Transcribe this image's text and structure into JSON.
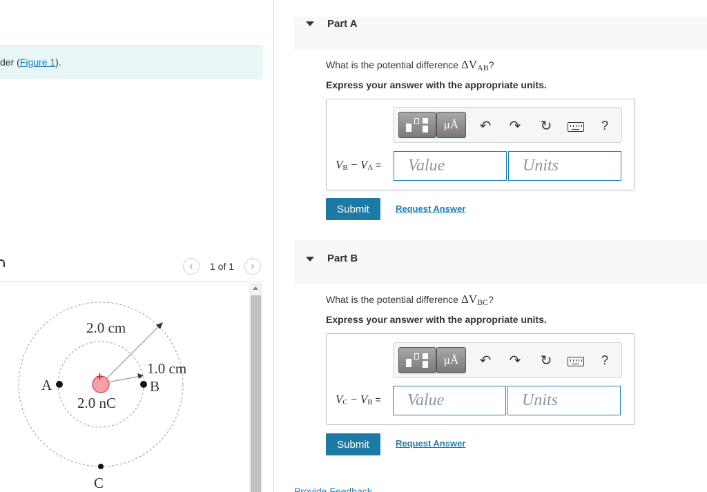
{
  "intro": {
    "text_prefix": "der (",
    "figure_link": "Figure 1",
    "text_suffix": ")."
  },
  "figure": {
    "pager": {
      "prev_icon": "chevron-left-icon",
      "next_icon": "chevron-right-icon",
      "current": "1 of 1"
    },
    "labels": {
      "point_a": "A",
      "point_b": "B",
      "point_c": "C",
      "charge_sign": "+",
      "charge_value": "2.0 nC",
      "outer_radius": "2.0 cm",
      "inner_radius": "1.0 cm"
    },
    "colors": {
      "charge_fill": "#f6a0a8",
      "charge_stroke": "#e0505e",
      "circle": "#999999"
    }
  },
  "parts": [
    {
      "title": "Part A",
      "question_prefix": "What is the potential difference ",
      "question_symbol": "ΔV",
      "question_sub": "AB",
      "question_suffix": "?",
      "instruction": "Express your answer with the appropriate units.",
      "toolbar": {
        "units_symbol": "μÅ",
        "undo_icon": "undo-icon",
        "redo_icon": "redo-icon",
        "reset_icon": "reset-icon",
        "keyboard_icon": "keyboard-icon",
        "help": "?"
      },
      "eq": {
        "v1": "V",
        "s1": "B",
        "minus": " − ",
        "v2": "V",
        "s2": "A",
        "equals": " ="
      },
      "value_placeholder": "Value",
      "units_placeholder": "Units",
      "submit": "Submit",
      "request": "Request Answer"
    },
    {
      "title": "Part B",
      "question_prefix": "What is the potential difference ",
      "question_symbol": "ΔV",
      "question_sub": "BC",
      "question_suffix": "?",
      "instruction": "Express your answer with the appropriate units.",
      "toolbar": {
        "units_symbol": "μÅ",
        "undo_icon": "undo-icon",
        "redo_icon": "redo-icon",
        "reset_icon": "reset-icon",
        "keyboard_icon": "keyboard-icon",
        "help": "?"
      },
      "eq": {
        "v1": "V",
        "s1": "C",
        "minus": " − ",
        "v2": "V",
        "s2": "B",
        "equals": " ="
      },
      "value_placeholder": "Value",
      "units_placeholder": "Units",
      "submit": "Submit",
      "request": "Request Answer"
    }
  ],
  "footer": {
    "feedback": "Provide Feedback"
  }
}
